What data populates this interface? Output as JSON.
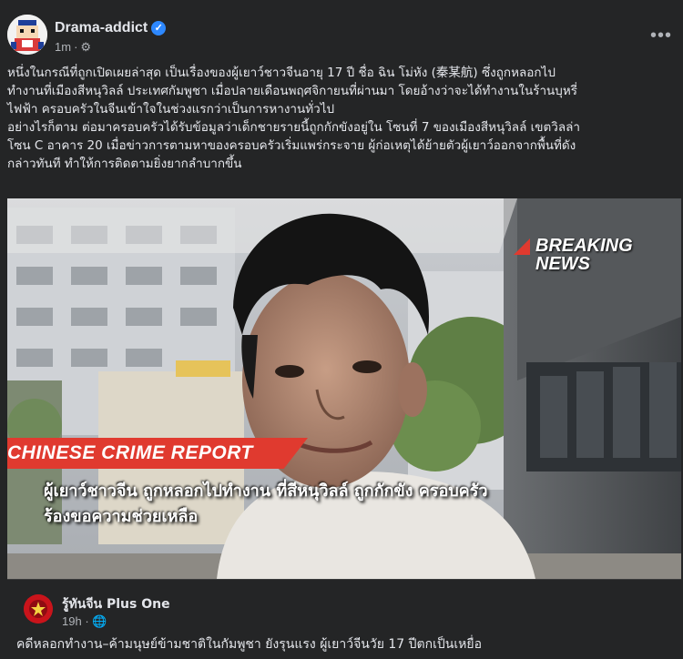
{
  "post": {
    "author": "Drama-addict",
    "time": "1m",
    "privacy_icon": "gear-icon",
    "more_icon": "more-dots-icon",
    "text_lines": [
      "หนึ่งในกรณีที่ถูกเปิดเผยล่าสุด เป็นเรื่องของผู้เยาว์ชาวจีนอายุ 17 ปี ชื่อ ฉิน โม่หัง (秦某航) ซึ่งถูกหลอกไป",
      "ทำงานที่เมืองสีหนุวิลล์ ประเทศกัมพูชา เมื่อปลายเดือนพฤศจิกายนที่ผ่านมา โดยอ้างว่าจะได้ทำงานในร้านบุหรี่",
      "ไฟฟ้า ครอบครัวในจีนเข้าใจในช่วงแรกว่าเป็นการหางานทั่วไป",
      "อย่างไรก็ตาม ต่อมาครอบครัวได้รับข้อมูลว่าเด็กชายรายนี้ถูกกักขังอยู่ใน โซนที่ 7 ของเมืองสีหนุวิลล์ เขตวิลล่า",
      "โซน C อาคาร 20 เมื่อข่าวการตามหาของครอบครัวเริ่มแพร่กระจาย ผู้ก่อเหตุได้ย้ายตัวผู้เยาว์ออกจากพื้นที่ดัง",
      "กล่าวทันที ทำให้การติดตามยิ่งยากลำบากขึ้น"
    ]
  },
  "media": {
    "breaking_line1": "BREAKING",
    "breaking_line2": "NEWS",
    "banner": "CHINESE CRIME REPORT",
    "caption_line1": "ผู้เยาว์ชาวจีน ถูกหลอกไปทำงาน ที่สีหนุวิลล์ ถูกกักขัง ครอบครัว",
    "caption_line2": "ร้องขอความช่วยเหลือ",
    "accent_color": "#e03a2f"
  },
  "shared": {
    "page_name": "รู้ทันจีน Plus One",
    "time": "19h",
    "privacy_icon": "globe-icon",
    "text": "คดีหลอกทำงาน–ค้ามนุษย์ข้ามชาติในกัมพูชา ยังรุนแรง ผู้เยาว์จีนวัย 17 ปีตกเป็นเหยื่อ"
  }
}
